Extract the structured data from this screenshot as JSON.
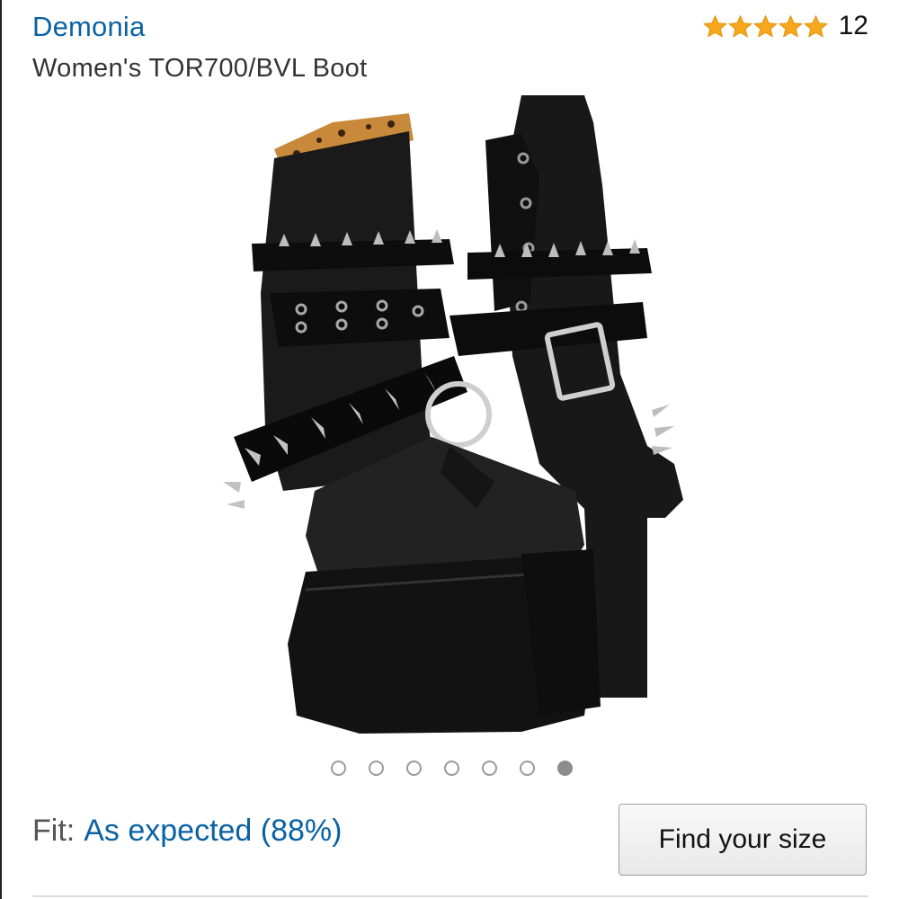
{
  "product": {
    "brand": "Demonia",
    "title": "Women's TOR700/BVL Boot",
    "rating_stars": 5,
    "rating_count": "12"
  },
  "carousel": {
    "total": 7,
    "active_index": 6
  },
  "fit": {
    "label": "Fit:",
    "value": "As expected (88%)"
  },
  "size_button": {
    "label": "Find your size"
  },
  "colors": {
    "link": "#0a62a5",
    "star": "#f7a71b",
    "boot": "#141414",
    "leopard": "#c88a3a"
  },
  "icons": [
    "star-icon",
    "boot-product-image",
    "carousel-dot"
  ]
}
